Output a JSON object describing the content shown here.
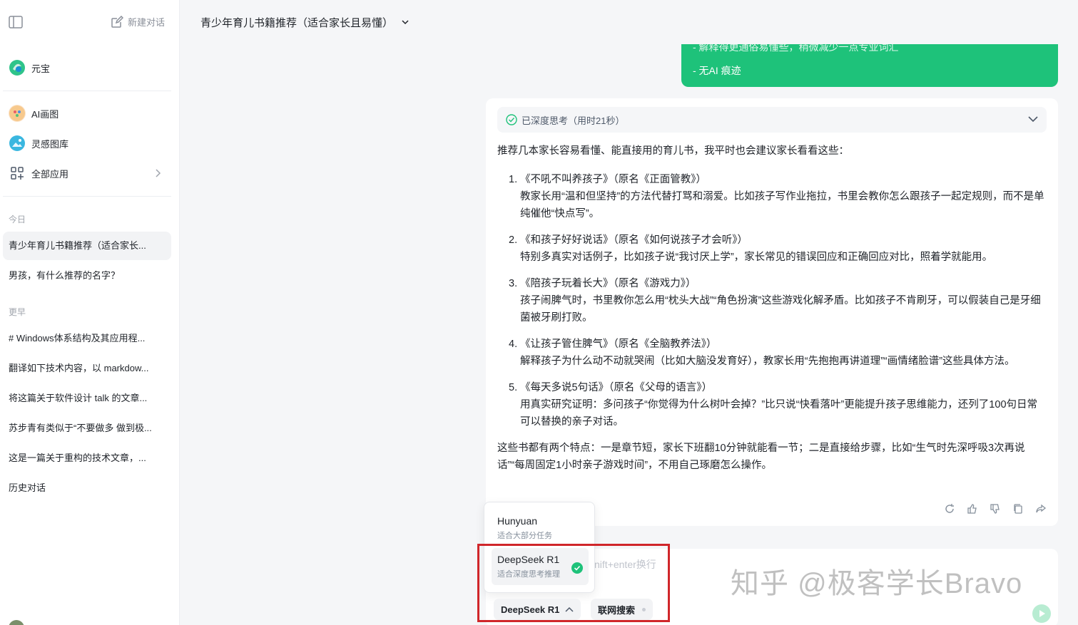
{
  "sidebar": {
    "new_chat": "新建对话",
    "apps": [
      {
        "label": "元宝",
        "icon": "yuanbao-logo-icon"
      },
      {
        "label": "AI画图",
        "icon": "ai-paint-icon"
      },
      {
        "label": "灵感图库",
        "icon": "gallery-icon"
      },
      {
        "label": "全部应用",
        "icon": "grid-apps-icon"
      }
    ],
    "section_today": "今日",
    "today": [
      "青少年育儿书籍推荐（适合家长...",
      "男孩，有什么推荐的名字？"
    ],
    "section_earlier": "更早",
    "earlier": [
      "# Windows体系结构及其应用程...",
      "翻译如下技术内容，以 markdow...",
      "将这篇关于软件设计 talk 的文章...",
      "苏步青有类似于“不要做多 做到极...",
      "这是一篇关于重构的技术文章，...",
      "历史对话"
    ]
  },
  "header": {
    "title": "青少年育儿书籍推荐（适合家长且易懂）"
  },
  "user_message": {
    "line1": "- 解释得更通俗易懂些，稍微减少一点专业词汇",
    "line2": "- 无AI 痕迹"
  },
  "answer": {
    "think_label": "已深度思考（用时21秒）",
    "intro": "推荐几本家长容易看懂、能直接用的育儿书，我平时也会建议家长看看这些：",
    "books": [
      {
        "num": "1.",
        "title": "《不吼不叫养孩子》（原名《正面管教》）",
        "desc": "教家长用“温和但坚持”的方法代替打骂和溺爱。比如孩子写作业拖拉，书里会教你怎么跟孩子一起定规则，而不是单纯催他“快点写”。"
      },
      {
        "num": "2.",
        "title": "《和孩子好好说话》（原名《如何说孩子才会听》）",
        "desc": "特别多真实对话例子，比如孩子说“我讨厌上学”，家长常见的错误回应和正确回应对比，照着学就能用。"
      },
      {
        "num": "3.",
        "title": "《陪孩子玩着长大》（原名《游戏力》）",
        "desc": "孩子闹脾气时，书里教你怎么用“枕头大战”“角色扮演”这些游戏化解矛盾。比如孩子不肯刷牙，可以假装自己是牙细菌被牙刷打败。"
      },
      {
        "num": "4.",
        "title": "《让孩子管住脾气》（原名《全脑教养法》）",
        "desc": "解释孩子为什么动不动就哭闹（比如大脑没发育好），教家长用“先抱抱再讲道理”“画情绪脸谱”这些具体方法。"
      },
      {
        "num": "5.",
        "title": "《每天多说5句话》（原名《父母的语言》）",
        "desc": "用真实研究证明：多问孩子“你觉得为什么树叶会掉？”比只说“快看落叶”更能提升孩子思维能力，还列了100句日常可以替换的亲子对话。"
      }
    ],
    "summary": "这些书都有两个特点：一是章节短，家长下班翻10分钟就能看一节；二是直接给步骤，比如“生气时先深呼吸3次再说话”“每周固定1小时亲子游戏时间”，不用自己琢磨怎么操作。",
    "tools": [
      "refresh-icon",
      "thumbs-up-icon",
      "thumbs-down-icon",
      "copy-icon",
      "share-icon"
    ]
  },
  "input": {
    "placeholder_fragment": "nift+enter换行"
  },
  "model_menu": {
    "options": [
      {
        "name": "Hunyuan",
        "desc": "适合大部分任务",
        "selected": false
      },
      {
        "name": "DeepSeek R1",
        "desc": "适合深度思考推理",
        "selected": true
      }
    ]
  },
  "chips": {
    "model": "DeepSeek R1",
    "web_search": "联网搜索"
  },
  "watermark": "知乎 @极客学长Bravo",
  "colors": {
    "accent": "#1ec27a",
    "highlight": "#d0262a"
  }
}
